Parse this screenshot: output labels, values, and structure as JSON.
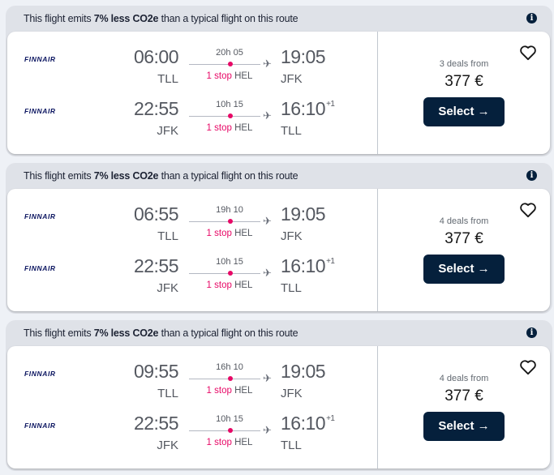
{
  "colors": {
    "accent_stop": "#e70866",
    "button_bg": "#05203c",
    "card_bg": "#dfe2e8"
  },
  "results": [
    {
      "eco_prefix": "This flight emits ",
      "eco_bold": "7% less CO2e",
      "eco_suffix": " than a typical flight on this route",
      "legs": [
        {
          "airline": "FINNAIR",
          "dep_time": "06:00",
          "dep_code": "TLL",
          "duration": "20h 05",
          "stops_label": "1 stop",
          "stop_code": "HEL",
          "arr_time": "19:05",
          "arr_day_offset": "",
          "arr_code": "JFK"
        },
        {
          "airline": "FINNAIR",
          "dep_time": "22:55",
          "dep_code": "JFK",
          "duration": "10h 15",
          "stops_label": "1 stop",
          "stop_code": "HEL",
          "arr_time": "16:10",
          "arr_day_offset": "+1",
          "arr_code": "TLL"
        }
      ],
      "deals": "3 deals from",
      "price": "377 €",
      "select_label": "Select →"
    },
    {
      "eco_prefix": "This flight emits ",
      "eco_bold": "7% less CO2e",
      "eco_suffix": " than a typical flight on this route",
      "legs": [
        {
          "airline": "FINNAIR",
          "dep_time": "06:55",
          "dep_code": "TLL",
          "duration": "19h 10",
          "stops_label": "1 stop",
          "stop_code": "HEL",
          "arr_time": "19:05",
          "arr_day_offset": "",
          "arr_code": "JFK"
        },
        {
          "airline": "FINNAIR",
          "dep_time": "22:55",
          "dep_code": "JFK",
          "duration": "10h 15",
          "stops_label": "1 stop",
          "stop_code": "HEL",
          "arr_time": "16:10",
          "arr_day_offset": "+1",
          "arr_code": "TLL"
        }
      ],
      "deals": "4 deals from",
      "price": "377 €",
      "select_label": "Select →"
    },
    {
      "eco_prefix": "This flight emits ",
      "eco_bold": "7% less CO2e",
      "eco_suffix": " than a typical flight on this route",
      "legs": [
        {
          "airline": "FINNAIR",
          "dep_time": "09:55",
          "dep_code": "TLL",
          "duration": "16h 10",
          "stops_label": "1 stop",
          "stop_code": "HEL",
          "arr_time": "19:05",
          "arr_day_offset": "",
          "arr_code": "JFK"
        },
        {
          "airline": "FINNAIR",
          "dep_time": "22:55",
          "dep_code": "JFK",
          "duration": "10h 15",
          "stops_label": "1 stop",
          "stop_code": "HEL",
          "arr_time": "16:10",
          "arr_day_offset": "+1",
          "arr_code": "TLL"
        }
      ],
      "deals": "4 deals from",
      "price": "377 €",
      "select_label": "Select →"
    }
  ],
  "icons": {
    "info": "i",
    "plane": "✈"
  }
}
